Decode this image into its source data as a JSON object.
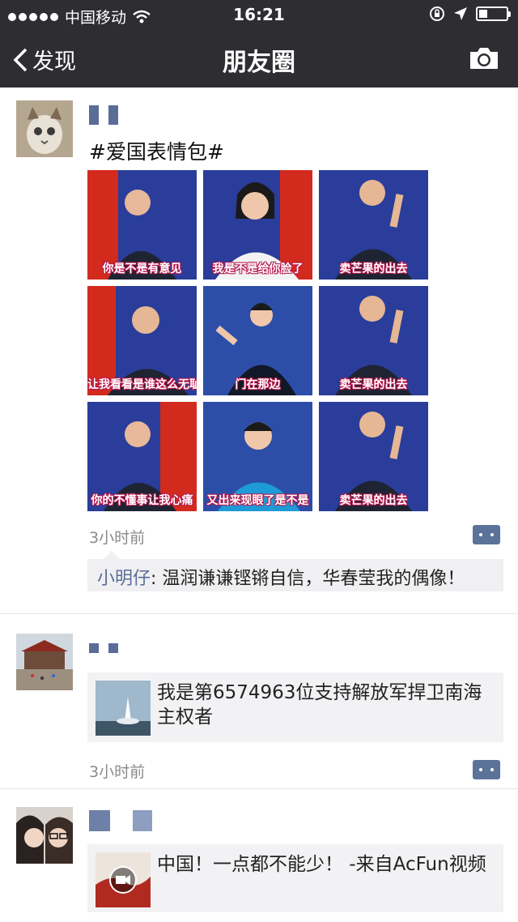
{
  "status_bar": {
    "carrier": "中国移动",
    "time": "16:21"
  },
  "nav": {
    "back_label": "发现",
    "title": "朋友圈"
  },
  "posts": [
    {
      "text": "#爱国表情包#",
      "images": [
        "你是不是有意见",
        "我是不是给你脸了",
        "卖芒果的出去",
        "让我看看是谁这么无耻",
        "门在那边",
        "卖芒果的出去",
        "你的不懂事让我心痛",
        "又出来现眼了是不是",
        "卖芒果的出去"
      ],
      "time": "3小时前",
      "comment": {
        "author": "小明仔",
        "separator": ": ",
        "text": "温润谦谦铿锵自信，华春莹我的偶像！"
      }
    },
    {
      "share_title": "我是第6574963位支持解放军捍卫南海主权者",
      "time": "3小时前"
    },
    {
      "share_title": "中国！一点都不能少！ -来自AcFun视频"
    }
  ],
  "colors": {
    "bar_bg": "#2e2e32",
    "name_blue": "#596d97",
    "caption_outline": "#b6154b"
  }
}
